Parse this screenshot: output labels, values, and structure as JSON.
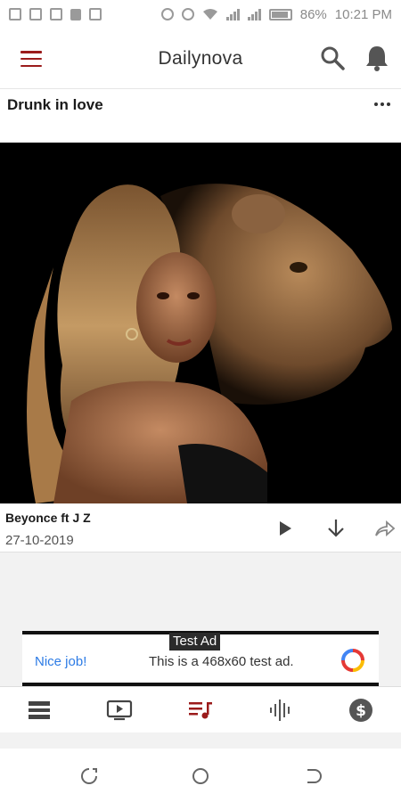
{
  "status_bar": {
    "battery": "86%",
    "time": "10:21 PM"
  },
  "app_bar": {
    "title": "Dailynova"
  },
  "post": {
    "title": "Drunk in love",
    "artist": "Beyonce ft J Z",
    "date": "27-10-2019"
  },
  "ad": {
    "label": "Test Ad",
    "nice": "Nice job!",
    "text": "This is a 468x60 test ad."
  },
  "colors": {
    "accent": "#9b1b1b",
    "icon_gray": "#666666",
    "ad_link": "#2c7be5"
  },
  "bottom_nav": {
    "items": [
      "list-icon",
      "video-icon",
      "playlist-icon",
      "audio-wave-icon",
      "dollar-icon"
    ],
    "active": "playlist-icon"
  }
}
